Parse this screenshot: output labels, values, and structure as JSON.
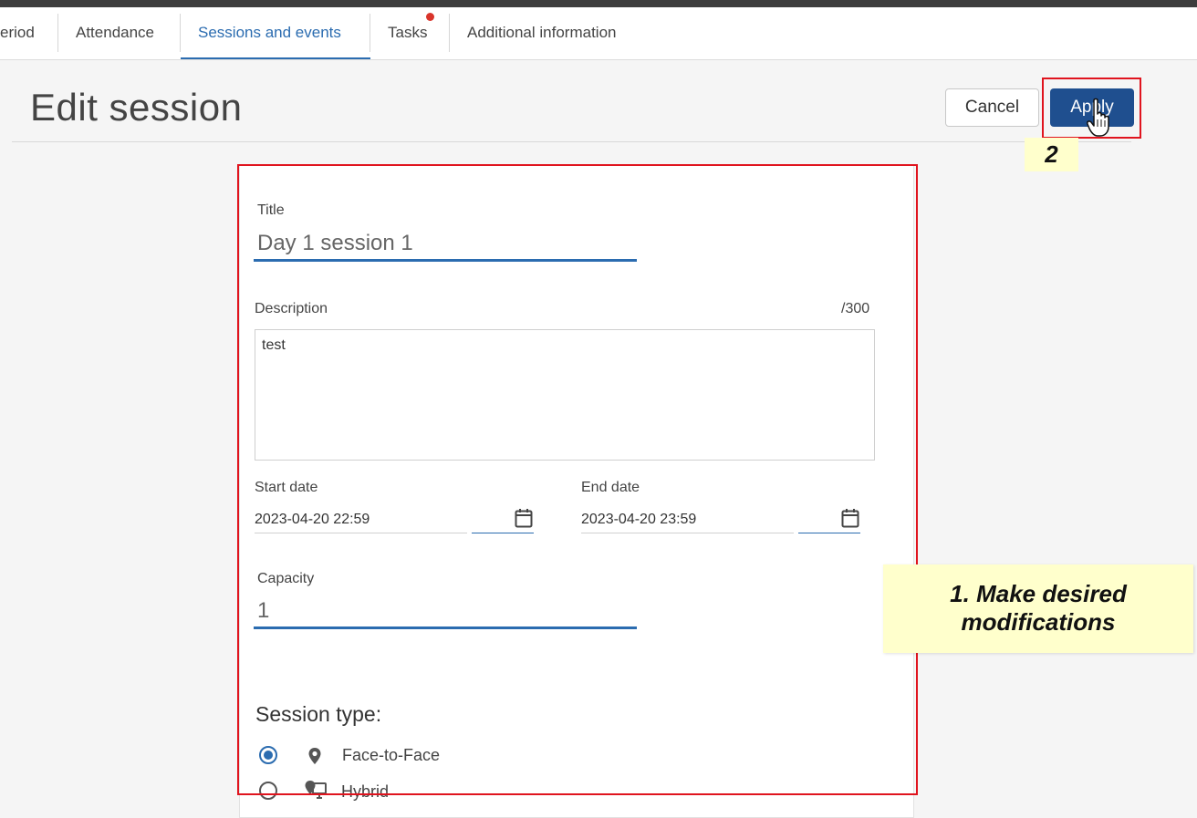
{
  "tabs": [
    {
      "label": "eriod",
      "active": false
    },
    {
      "label": "Attendance",
      "active": false
    },
    {
      "label": "Sessions and events",
      "active": true
    },
    {
      "label": "Tasks",
      "active": false,
      "has_notification": true
    },
    {
      "label": "Additional information",
      "active": false
    }
  ],
  "header": {
    "title": "Edit session",
    "cancel_label": "Cancel",
    "apply_label": "Apply"
  },
  "form": {
    "title_label": "Title",
    "title_value": "Day 1 session 1",
    "description_label": "Description",
    "description_counter": "/300",
    "description_value": "test",
    "start_date_label": "Start date",
    "start_date_value": "2023-04-20 22:59",
    "end_date_label": "End date",
    "end_date_value": "2023-04-20 23:59",
    "capacity_label": "Capacity",
    "capacity_value": "1",
    "session_type_heading": "Session type:",
    "session_types": [
      {
        "label": "Face-to-Face",
        "selected": true,
        "icon": "map-pin-icon"
      },
      {
        "label": "Hybrid",
        "selected": false,
        "icon": "hybrid-icon"
      }
    ]
  },
  "annotations": {
    "step1": "1. Make desired modifications",
    "step2": "2"
  },
  "colors": {
    "accent": "#2b6cb0",
    "apply_button": "#1f4f8f",
    "highlight_border": "#e0141e",
    "callout_bg": "#ffffcc",
    "notification_dot": "#d9342b"
  }
}
